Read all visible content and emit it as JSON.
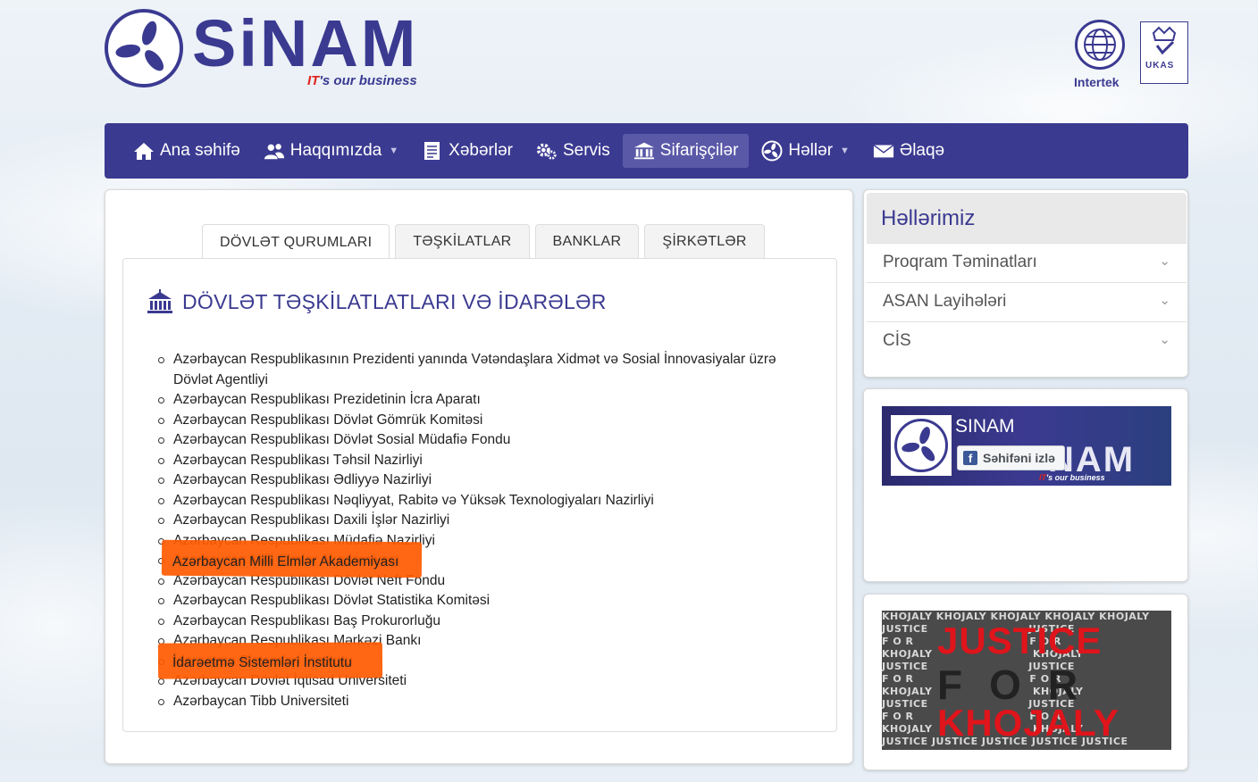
{
  "header": {
    "logo_text": "SiNAM",
    "tagline_it": "IT",
    "tagline_rest": "'s our business",
    "cert_intertek": "Intertek",
    "cert_ukas": "UKAS"
  },
  "nav": {
    "items": [
      {
        "label": "Ana səhifə",
        "icon": "home-icon"
      },
      {
        "label": "Haqqımızda",
        "icon": "users-icon"
      },
      {
        "label": "Xəbərlər",
        "icon": "news-icon"
      },
      {
        "label": "Servis",
        "icon": "gears-icon"
      },
      {
        "label": "Sifarişçilər",
        "icon": "building-icon"
      },
      {
        "label": "Həllər",
        "icon": "solutions-icon"
      },
      {
        "label": "Əlaqə",
        "icon": "mail-icon"
      }
    ],
    "active": "Sifarişçilər"
  },
  "tabs": [
    {
      "label": "DÖVLƏT QURUMLARI"
    },
    {
      "label": "TƏŞKİLATLAR"
    },
    {
      "label": "BANKLAR"
    },
    {
      "label": "ŞİRKƏTLƏR"
    }
  ],
  "pane": {
    "title": "DÖVLƏT TƏŞKİLATLATLARI VƏ İDARƏLƏR",
    "items": [
      "Azərbaycan Respublikasının Prezidenti yanında Vətəndaşlara Xidmət və Sosial İnnovasiyalar üzrə Dövlət Agentliyi",
      "Azərbaycan Respublikası Prezidetinin İcra Aparatı",
      "Azərbaycan Respublikası Dövlət Gömrük Komitəsi",
      "Azərbaycan Respublikası Dövlət Sosial Müdafiə Fondu",
      "Azərbaycan Respublikası Təhsil Nazirliyi",
      "Azərbaycan Respublikası Ədliyyə Nazirliyi",
      "Azərbaycan Respublikası Nəqliyyat, Rabitə və Yüksək Texnologiyaları Nazirliyi",
      "Azərbaycan Respublikası Daxili İşlər Nazirliyi",
      "Azərbaycan Respublikası Müdafiə Nazirliyi",
      "Azərbaycan Milli Elmlər Akademiyası",
      "Azərbaycan Respublikası Dövlət Neft Fondu",
      "Azərbaycan Respublikası Dövlət Statistika Komitəsi",
      "Azərbaycan Respublikası Baş Prokurorluğu",
      "Azərbaycan Respublikası Mərkəzi Bankı",
      "İdarəetmə Sistemləri İnstitutu",
      "Azərbaycan Dövlət İqtisad Universiteti",
      "Azərbaycan Tibb Universiteti"
    ]
  },
  "sidebar": {
    "solutions_title": "Həllərimiz",
    "solutions": [
      {
        "label": "Proqram Təminatları"
      },
      {
        "label": "ASAN Layihələri"
      },
      {
        "label": "CİS"
      }
    ],
    "facebook": {
      "page_name": "SINAM",
      "follow_label": "Səhifəni izlə",
      "banner_text": "NAM",
      "tag_it": "IT",
      "tag_rest": "'s our business"
    },
    "justice": {
      "line1": "JUSTICE",
      "line2": "FOR",
      "line3": "KHOJALY",
      "bg_words": "KHOJALY KHOJALY KHOJALY KHOJALY KHOJALY\nJUSTICE                          JUSTICE\nF O R                              F O R\nKHOJALY                          KHOJALY\nJUSTICE                          JUSTICE\nF O R                              F O R\nKHOJALY                          KHOJALY\nJUSTICE                          JUSTICE\nF O R                              F O R\nKHOJALY                          KHOJALY\nJUSTICE JUSTICE JUSTICE JUSTICE JUSTICE"
    }
  },
  "colors": {
    "brand": "#3b3a91",
    "highlight": "#ff5a00",
    "accent_red": "#e0231c"
  }
}
